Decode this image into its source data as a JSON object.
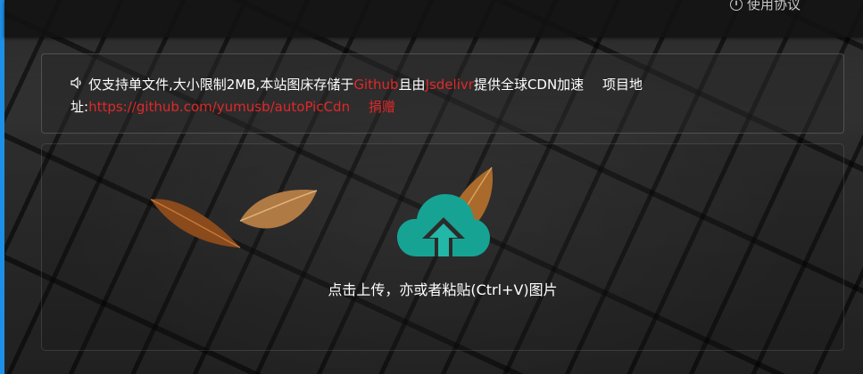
{
  "header": {
    "terms_label": "使用协议",
    "terms_icon": "info-icon"
  },
  "notice": {
    "icon": "speaker-icon",
    "text_1": "仅支持单文件,大小限制2MB,本站图床存储于",
    "github_label": "Github",
    "text_2": "且由",
    "jsdelivr_label": "Jsdelivr",
    "text_3": "提供全球CDN加速",
    "project_label": "项目地址:",
    "project_url": "https://github.com/yumusb/autoPicCdn",
    "donate_label": "捐赠"
  },
  "upload": {
    "icon": "cloud-upload-icon",
    "prompt": "点击上传，亦或者粘贴(Ctrl+V)图片"
  },
  "colors": {
    "accent": "#1e8fe6",
    "link_red": "#e0282a",
    "cloud_teal": "#16a394",
    "cloud_arrow": "#22b7a6"
  }
}
